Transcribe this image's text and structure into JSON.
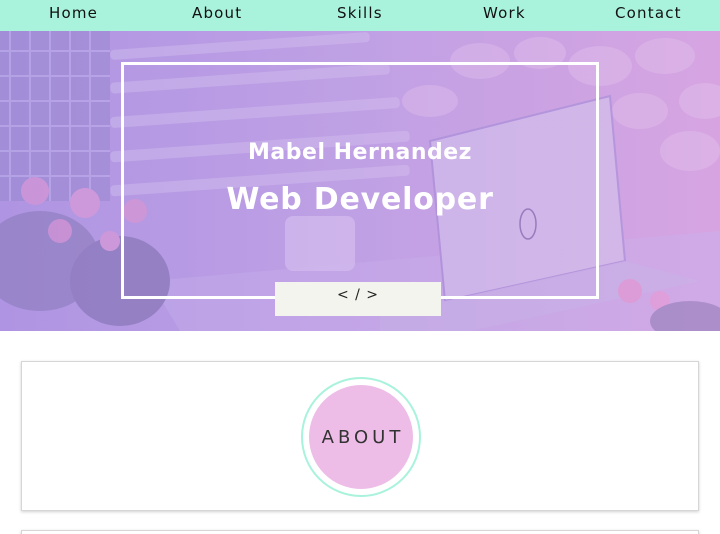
{
  "nav": {
    "items": [
      {
        "label": "Home"
      },
      {
        "label": "About"
      },
      {
        "label": "Skills"
      },
      {
        "label": "Work"
      },
      {
        "label": "Contact"
      }
    ]
  },
  "hero": {
    "name": "Mabel Hernandez",
    "role": "Web Developer",
    "code_tab": "< / >"
  },
  "about": {
    "heading": "ABOUT"
  },
  "colors": {
    "nav_bg": "#a9f2dc",
    "about_circle": "#edbde8",
    "ring": "#a9f2dc"
  }
}
